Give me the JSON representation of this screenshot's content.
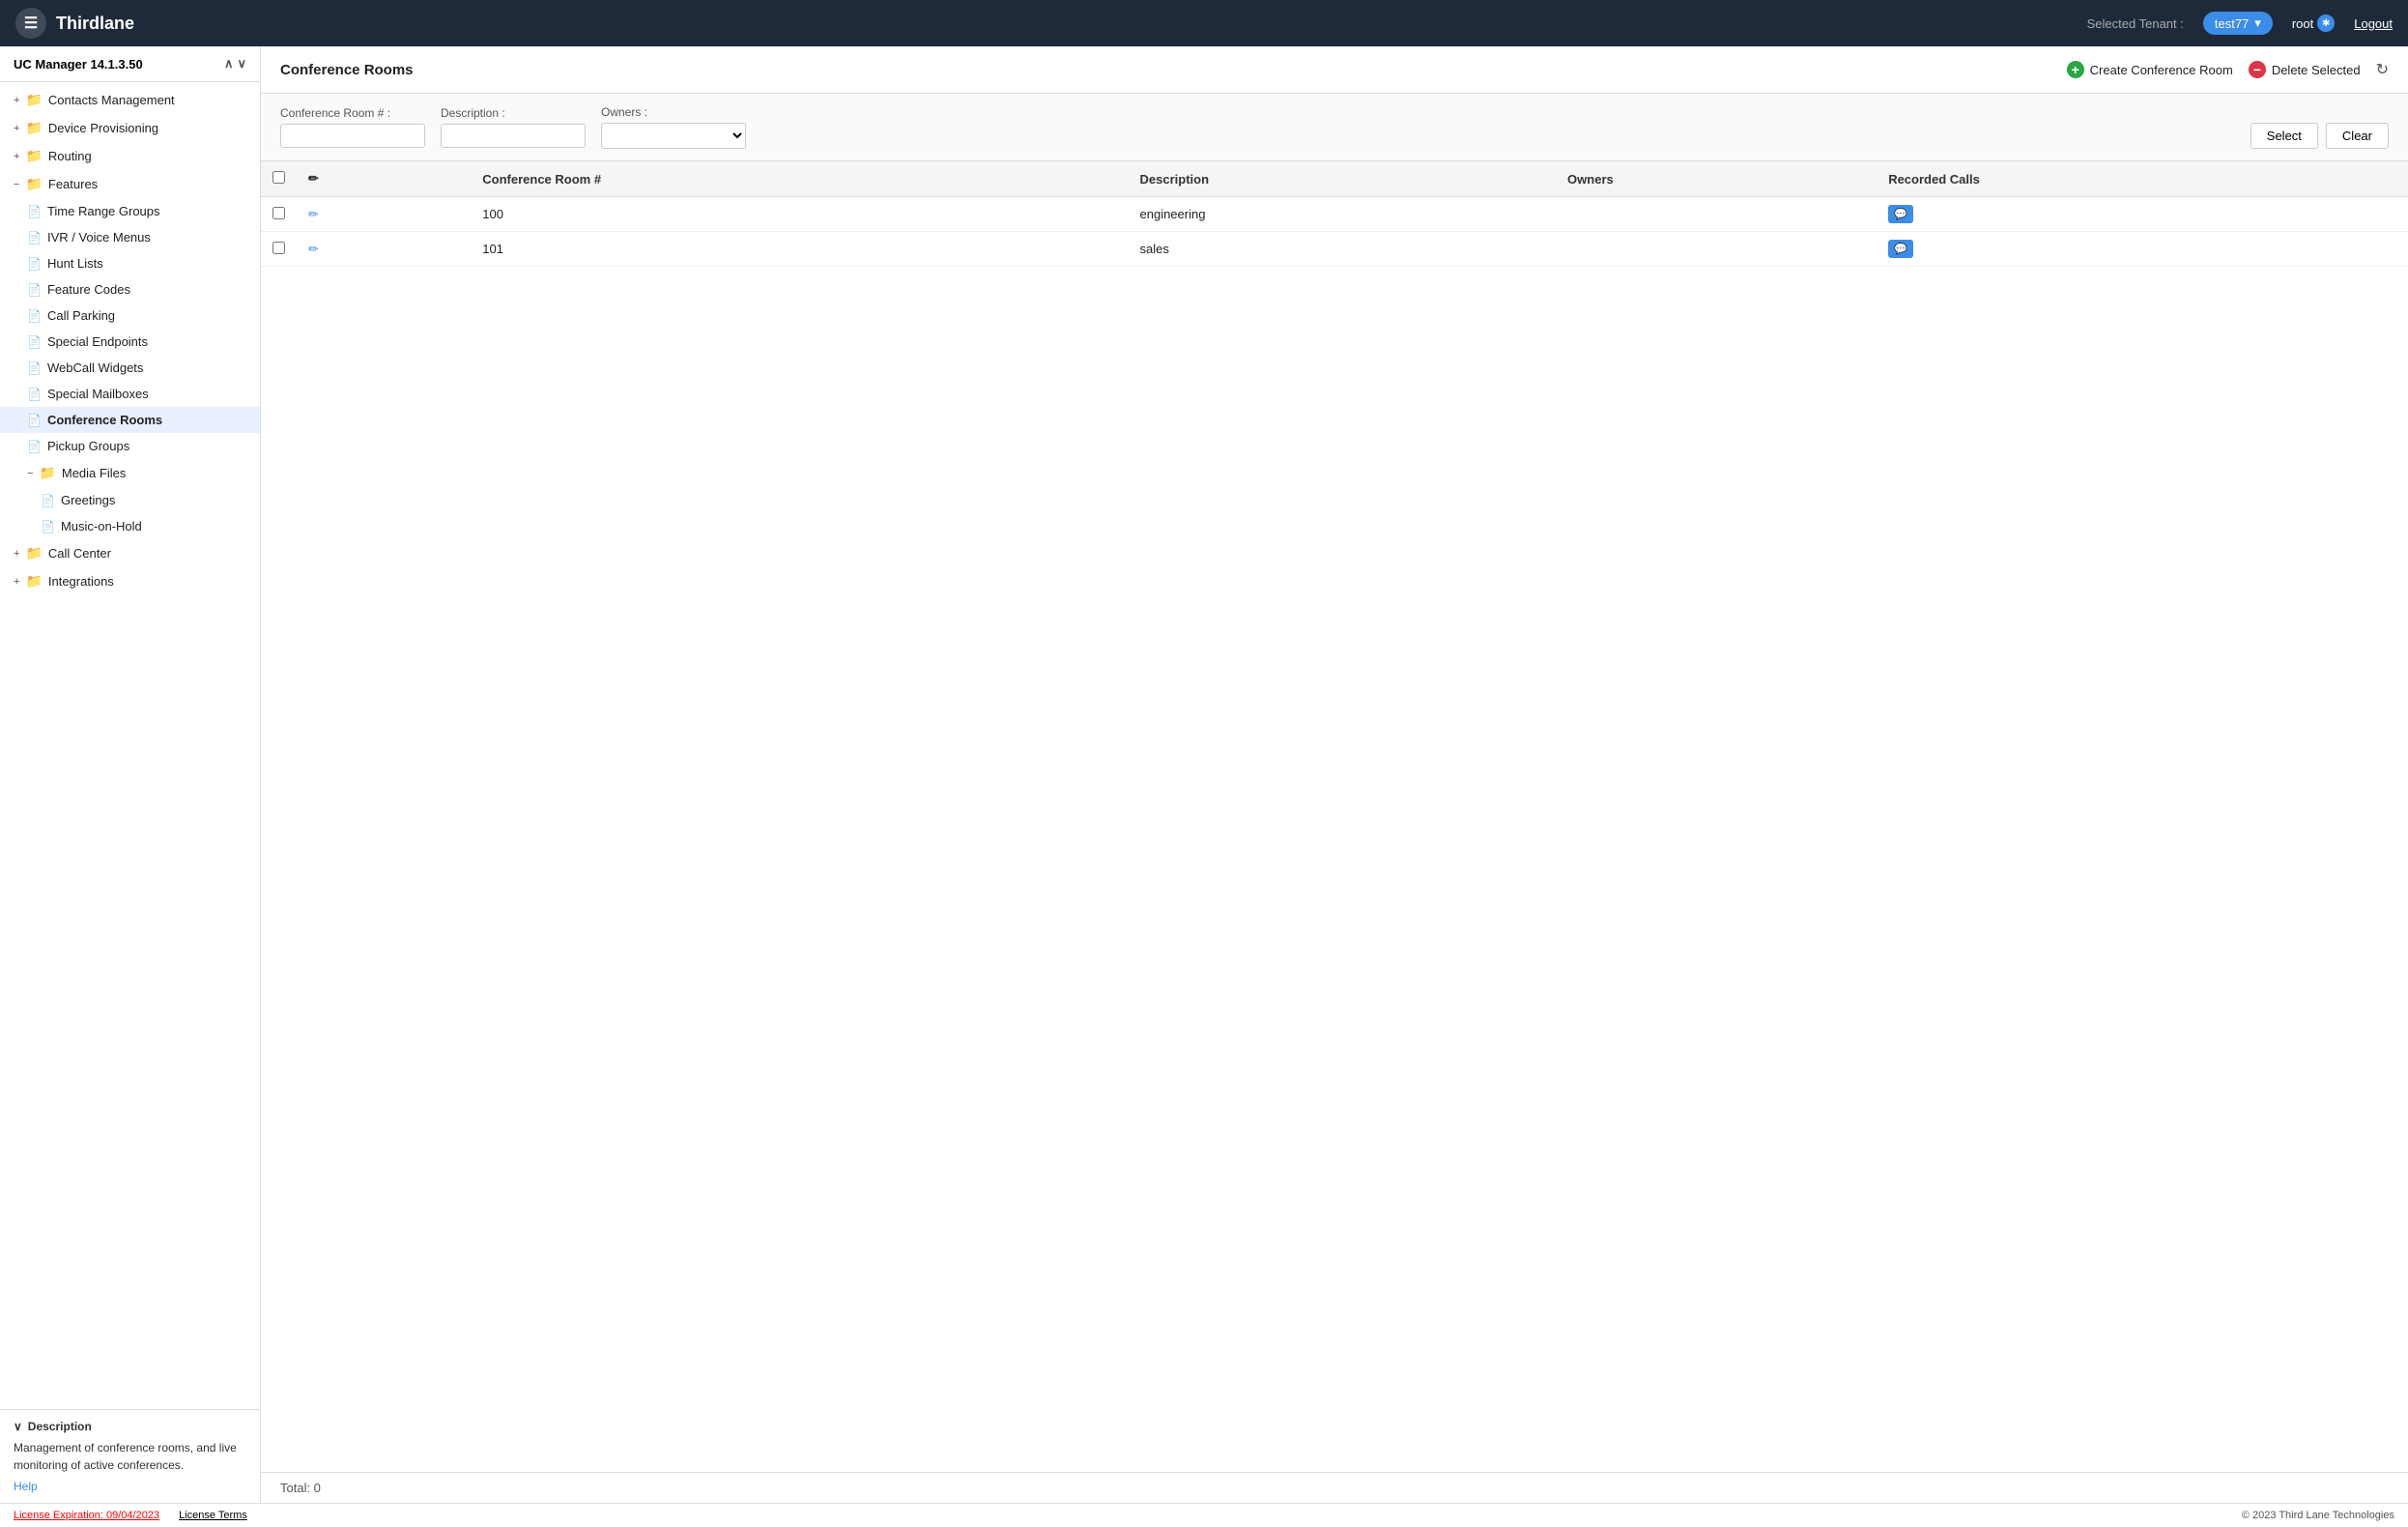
{
  "app": {
    "title": "Thirdlane"
  },
  "topbar": {
    "selected_tenant_label": "Selected Tenant :",
    "tenant": "test77",
    "user": "root",
    "logout_label": "Logout"
  },
  "sidebar": {
    "version": "UC Manager 14.1.3.50",
    "items": [
      {
        "id": "contacts-management",
        "label": "Contacts Management",
        "type": "folder",
        "indent": 0,
        "expanded": false,
        "prefix": "+"
      },
      {
        "id": "device-provisioning",
        "label": "Device Provisioning",
        "type": "folder",
        "indent": 0,
        "expanded": false,
        "prefix": "+"
      },
      {
        "id": "routing",
        "label": "Routing",
        "type": "folder",
        "indent": 0,
        "expanded": false,
        "prefix": "+"
      },
      {
        "id": "features",
        "label": "Features",
        "type": "folder",
        "indent": 0,
        "expanded": true,
        "prefix": "-"
      },
      {
        "id": "time-range-groups",
        "label": "Time Range Groups",
        "type": "page",
        "indent": 1
      },
      {
        "id": "ivr-voice-menus",
        "label": "IVR / Voice Menus",
        "type": "page",
        "indent": 1
      },
      {
        "id": "hunt-lists",
        "label": "Hunt Lists",
        "type": "page",
        "indent": 1
      },
      {
        "id": "feature-codes",
        "label": "Feature Codes",
        "type": "page",
        "indent": 1
      },
      {
        "id": "call-parking",
        "label": "Call Parking",
        "type": "page",
        "indent": 1
      },
      {
        "id": "special-endpoints",
        "label": "Special Endpoints",
        "type": "page",
        "indent": 1
      },
      {
        "id": "webcall-widgets",
        "label": "WebCall Widgets",
        "type": "page",
        "indent": 1
      },
      {
        "id": "special-mailboxes",
        "label": "Special Mailboxes",
        "type": "page",
        "indent": 1
      },
      {
        "id": "conference-rooms",
        "label": "Conference Rooms",
        "type": "page",
        "indent": 1,
        "active": true
      },
      {
        "id": "pickup-groups",
        "label": "Pickup Groups",
        "type": "page",
        "indent": 1
      },
      {
        "id": "media-files",
        "label": "Media Files",
        "type": "folder",
        "indent": 1,
        "expanded": true,
        "prefix": "-"
      },
      {
        "id": "greetings",
        "label": "Greetings",
        "type": "page",
        "indent": 2
      },
      {
        "id": "music-on-hold",
        "label": "Music-on-Hold",
        "type": "page",
        "indent": 2
      },
      {
        "id": "call-center",
        "label": "Call Center",
        "type": "folder",
        "indent": 0,
        "expanded": false,
        "prefix": "+"
      },
      {
        "id": "integrations",
        "label": "Integrations",
        "type": "folder",
        "indent": 0,
        "expanded": false,
        "prefix": "+"
      }
    ],
    "description_section": {
      "title": "Description",
      "text": "Management of conference rooms, and live monitoring of active conferences.",
      "help_label": "Help"
    }
  },
  "content": {
    "title": "Conference Rooms",
    "actions": {
      "create_label": "Create Conference Room",
      "delete_label": "Delete Selected"
    },
    "filter": {
      "room_number_label": "Conference Room # :",
      "room_number_placeholder": "",
      "description_label": "Description :",
      "description_placeholder": "",
      "owners_label": "Owners :",
      "owners_placeholder": "",
      "select_button": "Select",
      "clear_button": "Clear"
    },
    "table": {
      "columns": [
        "",
        "",
        "Conference Room #",
        "Description",
        "Owners",
        "Recorded Calls"
      ],
      "rows": [
        {
          "id": "100",
          "description": "engineering",
          "owners": "",
          "has_recorded": true
        },
        {
          "id": "101",
          "description": "sales",
          "owners": "",
          "has_recorded": true
        }
      ]
    },
    "footer": {
      "total_label": "Total: 0"
    }
  },
  "bottom_bar": {
    "license_expiration": "License Expiration: 09/04/2023",
    "license_terms": "License Terms",
    "copyright": "© 2023 Third Lane Technologies"
  }
}
